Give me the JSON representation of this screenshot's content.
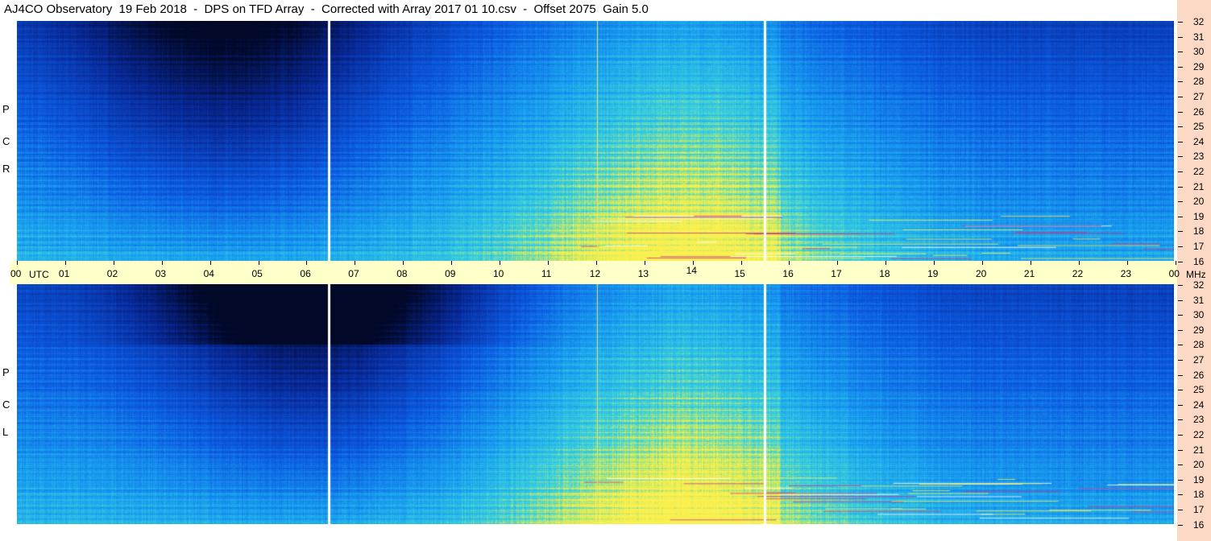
{
  "header": {
    "title": "AJ4CO Observatory  19 Feb 2018  -  DPS on TFD Array  -  Corrected with Array 2017 01 10.csv  -  Offset 2075  Gain 5.0"
  },
  "panels": {
    "top_label": [
      "R",
      "C",
      "P"
    ],
    "bottom_label": [
      "L",
      "C",
      "P"
    ]
  },
  "time_axis": {
    "utc_label": "UTC",
    "mhz_label": "MHz",
    "hours": [
      "00",
      "01",
      "02",
      "03",
      "04",
      "05",
      "06",
      "07",
      "08",
      "09",
      "10",
      "11",
      "12",
      "13",
      "14",
      "15",
      "16",
      "17",
      "18",
      "19",
      "20",
      "21",
      "22",
      "23",
      "00"
    ]
  },
  "freq_axis": {
    "labels": [
      "32",
      "31",
      "30",
      "29",
      "28",
      "27",
      "26",
      "25",
      "24",
      "23",
      "22",
      "21",
      "20",
      "19",
      "18",
      "17",
      "16"
    ]
  },
  "colors": {
    "background": "#ffffff",
    "time_bar": "#ffffc9",
    "right_strip": "#fcd9c4",
    "spectrogram_dark": "#02092e",
    "spectrogram_mid": "#0a5ae0",
    "spectrogram_light": "#1eb4f0",
    "spectrogram_hot": "#f0f05a"
  }
}
